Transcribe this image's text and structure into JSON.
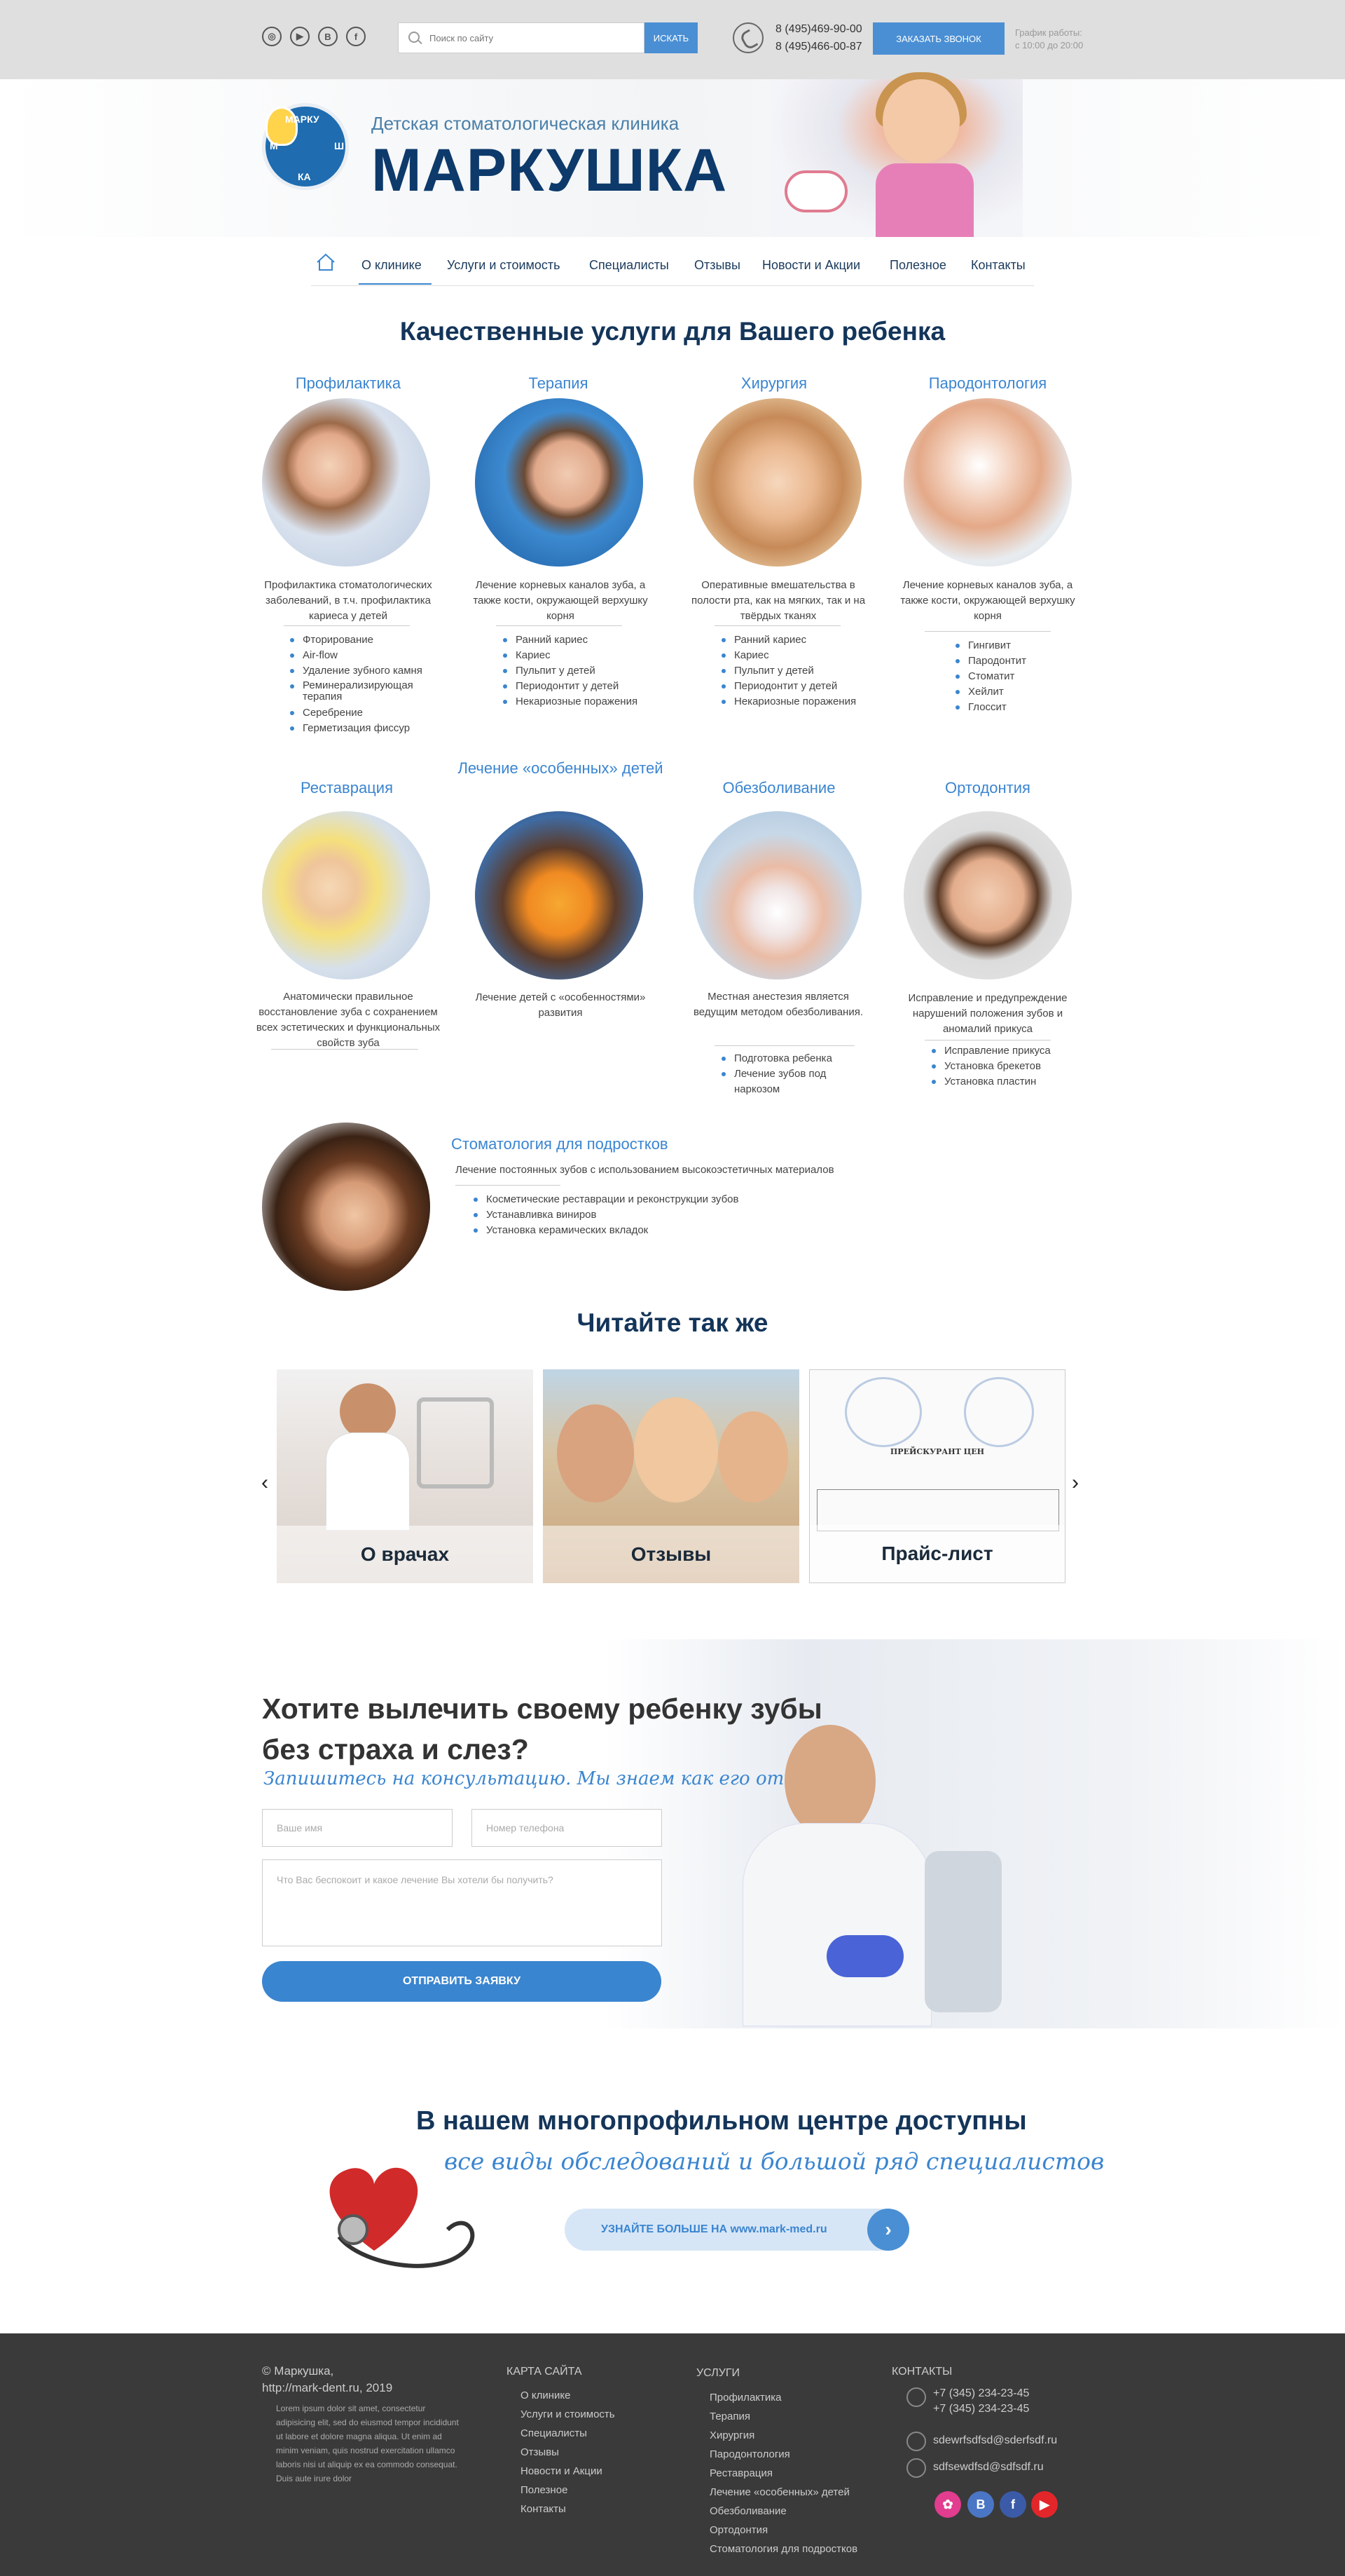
{
  "topbar": {
    "social_icons": [
      "globe-icon",
      "youtube-icon",
      "vk-icon",
      "facebook-icon"
    ],
    "social_glyphs": [
      "◎",
      "▶",
      "B",
      "f"
    ],
    "search_placeholder": "Поиск по сайту",
    "search_button": "ИСКАТЬ",
    "phones": [
      "8 (495)469-90-00",
      "8 (495)466-00-87"
    ],
    "call_button": "ЗАКАЗАТЬ ЗВОНОК",
    "hours_label": "График работы:",
    "hours_value": "с 10:00 до 20:00"
  },
  "header": {
    "logo_text": "МАРКУШКА",
    "subtitle": "Детская стоматологическая клиника",
    "brand": "МАРКУШКА"
  },
  "nav": {
    "items": [
      "О клинике",
      "Услуги и стоимость",
      "Специалисты",
      "Отзывы",
      "Новости и Акции",
      "Полезное",
      "Контакты"
    ],
    "active": "О клинике"
  },
  "services": {
    "title": "Качественные услуги для Вашего ребенка",
    "items": [
      {
        "title": "Профилактика",
        "desc": "Профилактика стоматологических заболеваний, в т.ч. профилактика кариеса у детей",
        "list": [
          "Фторирование",
          "Air-flow",
          "Удаление зубного камня",
          "Реминерализирующая терапия",
          "Серебрение",
          "Герметизация фиссур"
        ]
      },
      {
        "title": "Терапия",
        "desc": "Лечение корневых каналов зуба, а также кости, окружающей верхушку корня",
        "list": [
          "Ранний кариес",
          "Кариес",
          "Пульпит у детей",
          "Периодонтит у детей",
          "Некариозные поражения"
        ]
      },
      {
        "title": "Хирургия",
        "desc": "Оперативные вмешательства в полости рта, как на мягких, так и на твёрдых тканях",
        "list": [
          "Ранний кариес",
          "Кариес",
          "Пульпит у детей",
          "Периодонтит у детей",
          "Некариозные поражения"
        ]
      },
      {
        "title": "Пародонтология",
        "desc": "Лечение корневых каналов зуба, а также кости, окружающей верхушку корня",
        "list": [
          "Гингивит",
          "Пародонтит",
          "Стоматит",
          "Хейлит",
          "Глоссит"
        ]
      },
      {
        "title": "Реставрация",
        "desc": "Анатомически правильное восстановление зуба с сохранением всех эстетических и функциональных свойств зуба",
        "list": []
      },
      {
        "title": "Лечение «особенных» детей",
        "desc": "Лечение детей с «особенностями» развития",
        "list": []
      },
      {
        "title": "Обезболивание",
        "desc": "Местная анестезия является ведущим методом обезболивания.",
        "list": [
          "Подготовка ребенка",
          "Лечение зубов под наркозом"
        ]
      },
      {
        "title": "Ортодонтия",
        "desc": "Исправление и предупреждение нарушений положения зубов и аномалий прикуса",
        "list": [
          "Исправление прикуса",
          "Установка брекетов",
          "Установка пластин"
        ]
      }
    ],
    "teen": {
      "title": "Стоматология для подростков",
      "desc": "Лечение постоянных зубов с использованием высокоэстетичных материалов",
      "list": [
        "Косметические реставрации и реконструкции зубов",
        "Устанавливка виниров",
        "Установка керамических вкладок"
      ]
    }
  },
  "read_also": {
    "title": "Читайте так же",
    "cards": [
      "О врачах",
      "Отзывы",
      "Прайс-лист"
    ],
    "doc_heading": "ПРЕЙСКУРАНТ ЦЕН",
    "prev": "‹",
    "next": "›"
  },
  "cta": {
    "title_line1": "Хотите вылечить своему ребенку зубы",
    "title_line2": "без страха и слез?",
    "subtitle": "Запишитесь на консультацию. Мы знаем как его отвлечь!",
    "name_placeholder": "Ваше имя",
    "phone_placeholder": "Номер телефона",
    "message_placeholder": "Что Вас беспокоит и какое лечение Вы хотели бы получить?",
    "submit": "ОТПРАВИТЬ ЗАЯВКУ"
  },
  "multiprofile": {
    "title": "В нашем многопрофильном центре доступны",
    "subtitle": "все виды обследований и большой ряд специалистов",
    "button": "УЗНАЙТЕ БОЛЬШЕ НА www.mark-med.ru",
    "button_arrow": "›"
  },
  "footer": {
    "copyright": "© Маркушка,",
    "url_year": "http://mark-dent.ru, 2019",
    "lorem": "Lorem ipsum dolor sit amet, consectetur adipisicing elit, sed do eiusmod tempor incididunt ut labore et dolore magna aliqua. Ut enim ad minim veniam, quis nostrud exercitation ullamco laboris nisi ut aliquip ex ea commodo consequat. Duis aute irure dolor",
    "sitemap_title": "КАРТА САЙТА",
    "sitemap": [
      "О клинике",
      "Услуги и стоимость",
      "Специалисты",
      "Отзывы",
      "Новости и Акции",
      "Полезное",
      "Контакты"
    ],
    "services_title": "УСЛУГИ",
    "services": [
      "Профилактика",
      "Терапия",
      "Хирургия",
      "Пародонтология",
      "Реставрация",
      "Лечение «особенных» детей",
      "Обезболивание",
      "Ортодонтия",
      "Стоматология для подростков"
    ],
    "contacts_title": "КОНТАКТЫ",
    "phones": [
      "+7 (345) 234-23-45",
      "+7 (345) 234-23-45"
    ],
    "emails": [
      "sdewrfsdfsd@sderfsdf.ru",
      "sdfsewdfsd@sdfsdf.ru"
    ],
    "social": [
      "dribbble-icon",
      "vk-icon",
      "facebook-icon",
      "youtube-icon"
    ],
    "social_glyphs": [
      "✿",
      "B",
      "f",
      "▶"
    ]
  },
  "colors": {
    "accent": "#3a85d0",
    "dark_blue": "#14355a",
    "footer_bg": "#3a3a3a",
    "topbar_bg": "#dfdfdf"
  }
}
